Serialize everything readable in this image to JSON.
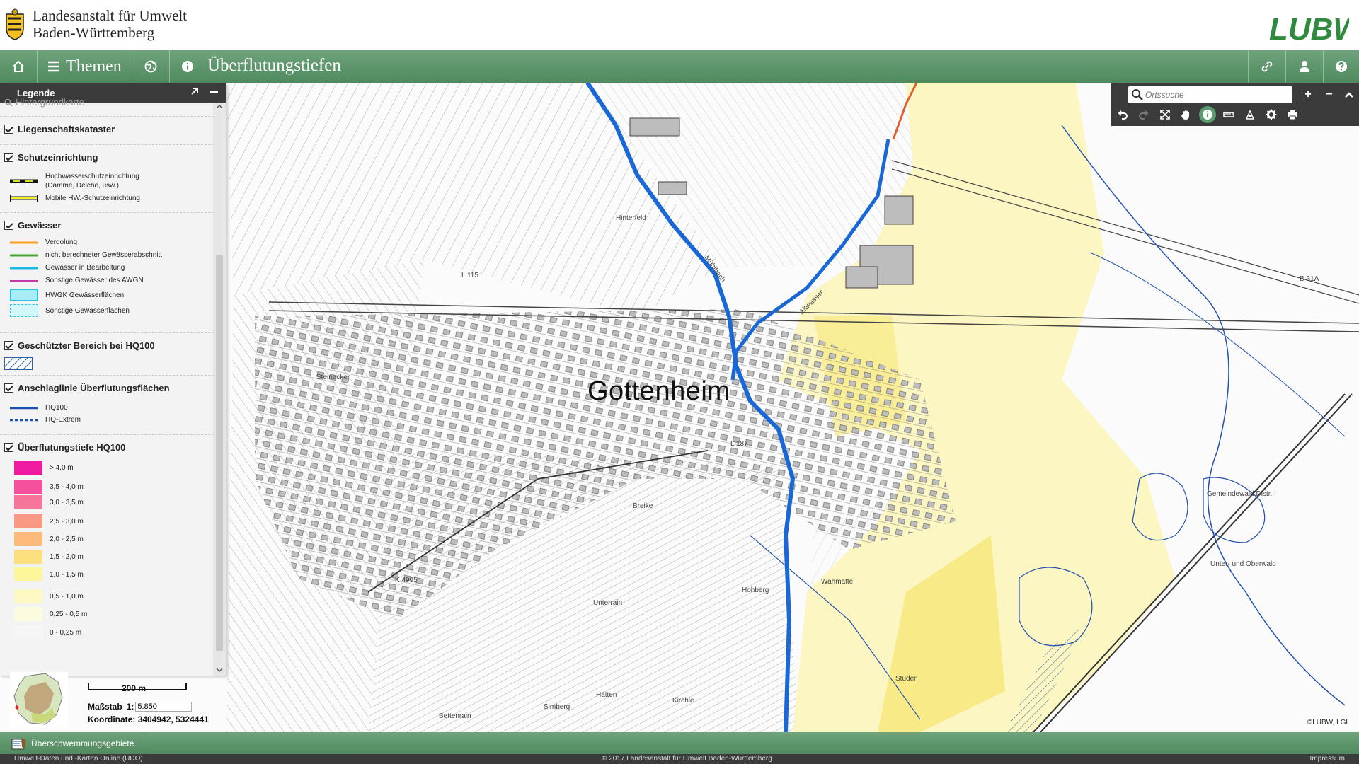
{
  "header": {
    "org_line1": "Landesanstalt für Umwelt",
    "org_line2": "Baden-Württemberg",
    "logo_text": "LUBW"
  },
  "navbar": {
    "home_icon": "home-icon",
    "themen_label": "Themen",
    "globe_icon": "globe-icon",
    "info_icon": "info-icon",
    "title": "Überflutungstiefen",
    "link_icon": "link-icon",
    "user_icon": "user-icon",
    "help_icon": "help-icon"
  },
  "map_tools": {
    "search_placeholder": "Ortssuche",
    "zoom_in": "+",
    "zoom_out": "−",
    "collapse": "^"
  },
  "map": {
    "town": "Gottenheim",
    "labels": {
      "muehlbach": "Mühlbach",
      "altwasser": "Altwasser",
      "steinacker": "Steinacker",
      "breike": "Breike",
      "unterrain": "Unterrain",
      "hohberg": "Hohberg",
      "wahmatte": "Wahmatte",
      "studen": "Studen",
      "hinterfeld": "Hinterfeld",
      "gemeindewald": "Gemeindewald Distr. I",
      "unter_oberwald": "Unter- und Oberwald",
      "b31a": "B 31A",
      "l115": "L 115",
      "l187": "L 187",
      "k4995": "K 4995",
      "haetten": "Hätten",
      "kirchle": "Kirchle",
      "bettenrain": "Bettenrain",
      "simberg": "Simberg"
    },
    "attribution": "©LUBW, LGL"
  },
  "legend": {
    "title": "Legende",
    "cut_label": "Hintergrundkarte",
    "groups": {
      "kataster": "Liegenschaftskataster",
      "schutz": {
        "title": "Schutzeinrichtung",
        "item1_line1": "Hochwasserschutzeinrichtung",
        "item1_line2": "(Dämme, Deiche, usw.)",
        "item2": "Mobile HW.-Schutzeinrichtung"
      },
      "gewaesser": {
        "title": "Gewässer",
        "items": [
          "Verdolung",
          "nicht berechneter Gewässerabschnitt",
          "Gewässer in Bearbeitung",
          "Sonstige Gewässer des AWGN",
          "HWGK Gewässerflächen",
          "Sonstige Gewässerflächen"
        ],
        "colors": [
          "#f5a020",
          "#3fae2a",
          "#1ab8e6",
          "#c23ca8"
        ]
      },
      "geschuetzt": "Geschützter Bereich bei HQ100",
      "anschlag": {
        "title": "Anschlaglinie Überflutungsflächen",
        "hq100": "HQ100",
        "hqextrem": "HQ-Extrem"
      },
      "tiefe": {
        "title": "Überflutungstiefe HQ100",
        "classes": [
          {
            "label": "> 4,0 m",
            "color": "#f01aa0"
          },
          {
            "label": "3,5 - 4,0 m",
            "color": "#f5509e"
          },
          {
            "label": "3,0 - 3,5 m",
            "color": "#f5769a"
          },
          {
            "label": "2,5 - 3,0 m",
            "color": "#fb9a84"
          },
          {
            "label": "2,0 - 2,5 m",
            "color": "#fcbb7c"
          },
          {
            "label": "1,5 - 2,0 m",
            "color": "#fde07e"
          },
          {
            "label": "1,0 - 1,5 m",
            "color": "#fdf69a"
          },
          {
            "label": "0,5 - 1,0 m",
            "color": "#fdf9c4"
          },
          {
            "label": "0,25 - 0,5 m",
            "color": "#fbfbe0"
          },
          {
            "label": "0 - 0,25 m",
            "color": "#f6f6f6"
          }
        ]
      }
    }
  },
  "scale": {
    "bar_label": "200 m",
    "massstab_label": "Maßstab",
    "massstab_prefix": "1:",
    "massstab_value": "5.850",
    "koordinate_label": "Koordinate:",
    "koordinate_value": "3404942, 5324441"
  },
  "tabbar": {
    "tab_label": "Überschwemmungsgebiete"
  },
  "footer": {
    "left": "Umwelt-Daten und -Karten Online (UDO)",
    "center": "© 2017 Landesanstalt für Umwelt Baden-Württemberg",
    "right": "Impressum"
  }
}
